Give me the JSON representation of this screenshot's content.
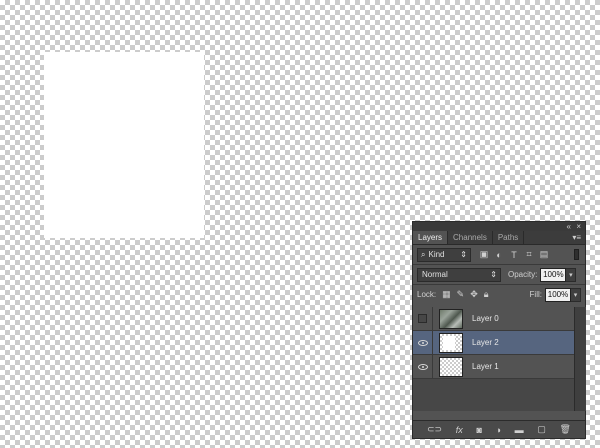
{
  "panel": {
    "collapse_icon": "double-chevron-icon",
    "close_icon": "close-icon",
    "tabs": [
      {
        "label": "Layers",
        "active": true
      },
      {
        "label": "Channels",
        "active": false
      },
      {
        "label": "Paths",
        "active": false
      }
    ],
    "filter": {
      "kind_label": "Kind",
      "icons": [
        "image-filter-icon",
        "adjustment-filter-icon",
        "type-filter-icon",
        "shape-filter-icon",
        "smart-object-filter-icon"
      ]
    },
    "blend_mode": "Normal",
    "opacity_label": "Opacity:",
    "opacity_value": "100%",
    "lock_label": "Lock:",
    "fill_label": "Fill:",
    "fill_value": "100%",
    "layers": [
      {
        "name": "Layer 0",
        "visible": false,
        "selected": false,
        "thumb": "photo"
      },
      {
        "name": "Layer 2",
        "visible": true,
        "selected": true,
        "thumb": "white-box"
      },
      {
        "name": "Layer 1",
        "visible": true,
        "selected": false,
        "thumb": "transparent"
      }
    ],
    "bottom_icons": [
      "link-layers-icon",
      "fx-icon",
      "layer-mask-icon",
      "adjustment-layer-icon",
      "new-group-icon",
      "new-layer-icon",
      "trash-icon"
    ]
  },
  "colors": {
    "panel_bg": "#535353",
    "selected_row": "#56657f"
  }
}
